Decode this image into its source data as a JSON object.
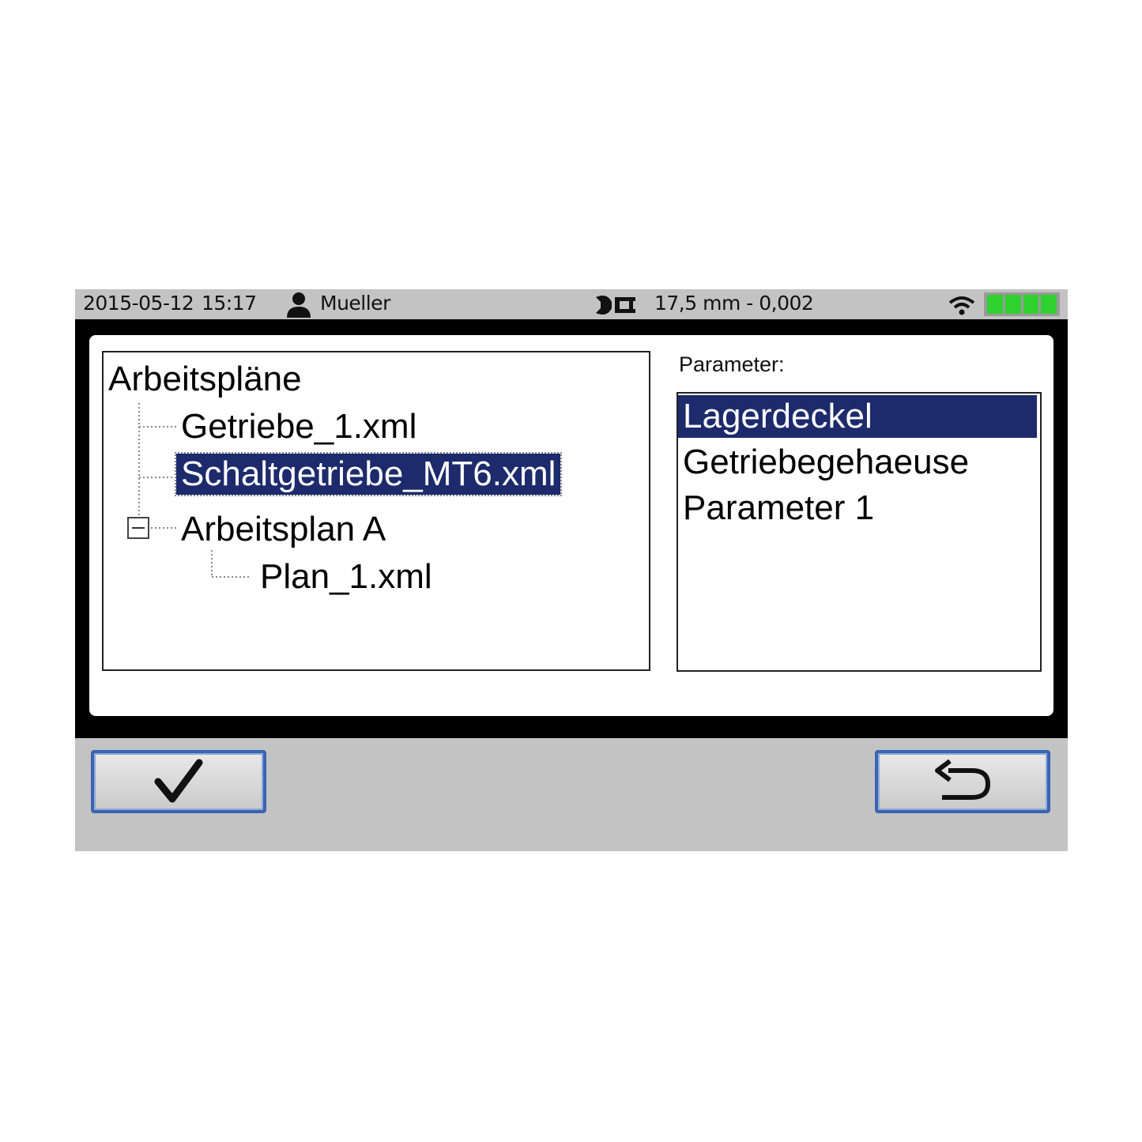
{
  "status_bar": {
    "date": "2015-05-12",
    "time": "15:17",
    "user": "Mueller",
    "user_icon": "user-icon",
    "tool_icon": "wrench-caliper-icon",
    "measurement": "17,5 mm - 0,002",
    "wifi_icon": "wifi-icon",
    "battery_level": 1.0,
    "battery_color": "#2fd12f"
  },
  "tree": {
    "root": "Arbeitspläne",
    "items": [
      {
        "label": "Getriebe_1.xml"
      },
      {
        "label": "Schaltgetriebe_MT6.xml",
        "selected": true
      },
      {
        "label": "Arbeitsplan A",
        "expanded": true
      },
      {
        "label": "Plan_1.xml"
      }
    ]
  },
  "parameters": {
    "label": "Parameter:",
    "items": [
      {
        "label": "Lagerdeckel",
        "selected": true
      },
      {
        "label": "Getriebegehaeuse"
      },
      {
        "label": "Parameter 1"
      }
    ]
  },
  "buttons": {
    "ok_icon": "checkmark-icon",
    "back_icon": "return-arrow-icon"
  },
  "colors": {
    "selection": "#1d2a6c",
    "button_border": "#3a64b2",
    "bar_gray": "#c3c3c3"
  }
}
